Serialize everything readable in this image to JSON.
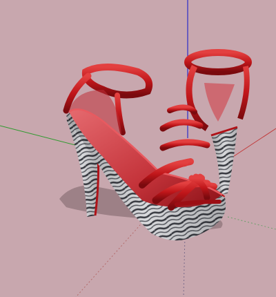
{
  "viewport": {
    "background_color": "#c8a7ae",
    "axis_colors": {
      "z": "#2a2ac8",
      "x": "#c23a3a",
      "y": "#2e9a2e"
    }
  },
  "scene": {
    "object": "pair-of-red-platform-sandals",
    "strap_color": "#c0161a",
    "strap_highlight": "#e34040",
    "strap_shadow": "#7a0a0e",
    "platform_pattern": "zebra-marble",
    "shadow_color": "#8f7479"
  }
}
